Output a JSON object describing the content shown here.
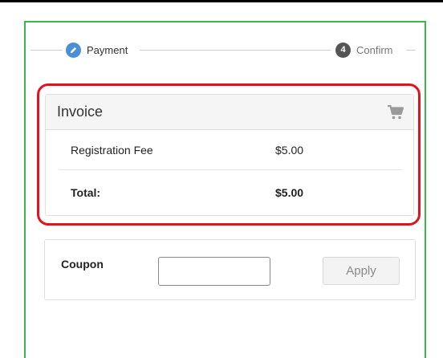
{
  "stepper": {
    "steps": [
      {
        "label": "Payment",
        "badge": "",
        "state": "active"
      },
      {
        "label": "Confirm",
        "badge": "4",
        "state": "pending"
      }
    ]
  },
  "invoice": {
    "title": "Invoice",
    "icon": "shopping-cart-icon",
    "rows": [
      {
        "label": "Registration Fee",
        "value": "$5.00"
      },
      {
        "label": "Total:",
        "value": "$5.00"
      }
    ]
  },
  "coupon": {
    "label": "Coupon",
    "input_value": "",
    "apply_label": "Apply"
  },
  "colors": {
    "highlight": "#e1141e",
    "frame": "#3cb54a",
    "step_active": "#4a8fd8"
  }
}
